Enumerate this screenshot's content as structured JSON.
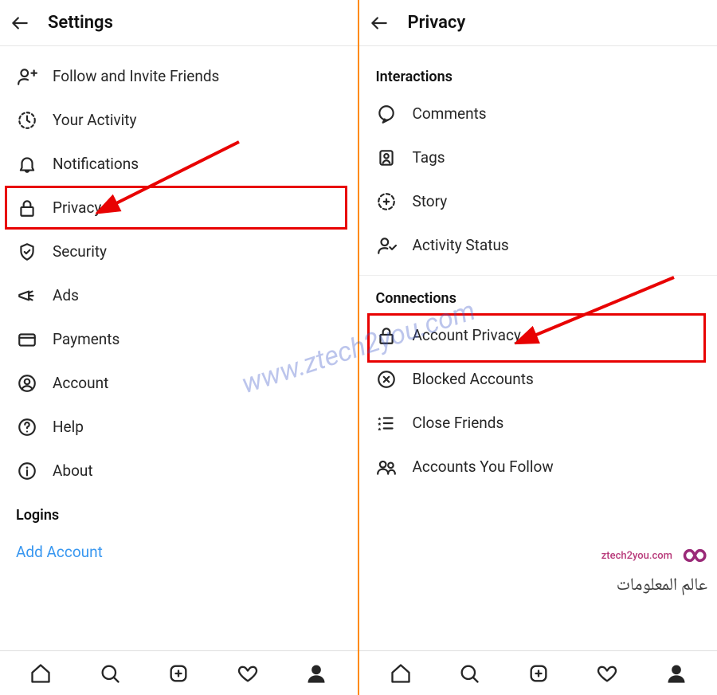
{
  "left": {
    "header": {
      "title": "Settings"
    },
    "items": [
      {
        "id": "follow-invite",
        "label": "Follow and Invite Friends",
        "icon": "person-plus-icon"
      },
      {
        "id": "activity",
        "label": "Your Activity",
        "icon": "clock-dashed-icon"
      },
      {
        "id": "notifications",
        "label": "Notifications",
        "icon": "bell-icon"
      },
      {
        "id": "privacy",
        "label": "Privacy",
        "icon": "lock-icon",
        "highlight": true
      },
      {
        "id": "security",
        "label": "Security",
        "icon": "shield-check-icon"
      },
      {
        "id": "ads",
        "label": "Ads",
        "icon": "megaphone-icon"
      },
      {
        "id": "payments",
        "label": "Payments",
        "icon": "card-icon"
      },
      {
        "id": "account",
        "label": "Account",
        "icon": "user-circle-icon"
      },
      {
        "id": "help",
        "label": "Help",
        "icon": "help-icon"
      },
      {
        "id": "about",
        "label": "About",
        "icon": "info-icon"
      }
    ],
    "logins": {
      "label": "Logins",
      "add_account": "Add Account"
    }
  },
  "right": {
    "header": {
      "title": "Privacy"
    },
    "sections": [
      {
        "label": "Interactions",
        "items": [
          {
            "id": "comments",
            "label": "Comments",
            "icon": "comment-icon"
          },
          {
            "id": "tags",
            "label": "Tags",
            "icon": "tag-person-icon"
          },
          {
            "id": "story",
            "label": "Story",
            "icon": "story-plus-icon"
          },
          {
            "id": "activity-status",
            "label": "Activity Status",
            "icon": "user-check-icon"
          }
        ]
      },
      {
        "label": "Connections",
        "items": [
          {
            "id": "account-privacy",
            "label": "Account Privacy",
            "icon": "lock-icon",
            "highlight": true
          },
          {
            "id": "blocked",
            "label": "Blocked Accounts",
            "icon": "x-circle-icon"
          },
          {
            "id": "close-friends",
            "label": "Close Friends",
            "icon": "star-list-icon"
          },
          {
            "id": "accounts-follow",
            "label": "Accounts You Follow",
            "icon": "people-icon"
          }
        ]
      }
    ]
  },
  "bottom_nav": [
    {
      "id": "home",
      "icon": "home-icon"
    },
    {
      "id": "search",
      "icon": "search-icon"
    },
    {
      "id": "add",
      "icon": "plus-square-icon"
    },
    {
      "id": "likes",
      "icon": "heart-icon"
    },
    {
      "id": "profile",
      "icon": "profile-icon",
      "active": true
    }
  ],
  "watermark": "www.ztech2you.com",
  "brand": {
    "url": "ztech2you.com",
    "arabic": "عالم المعلومات"
  },
  "annotations": {
    "highlight_color": "#e80202",
    "arrow_color": "#e80202"
  }
}
